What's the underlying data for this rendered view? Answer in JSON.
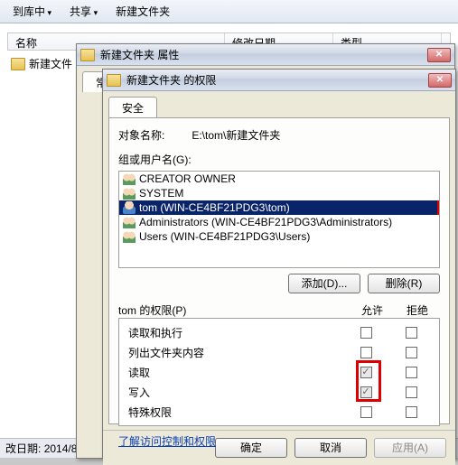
{
  "explorer": {
    "toolbar": {
      "include": "到库中",
      "share": "共享",
      "new_folder": "新建文件夹"
    },
    "columns": {
      "name": "名称",
      "modified": "修改日期",
      "type": "类型"
    },
    "file_row": "新建文件",
    "status_prefix": "改日期:",
    "status_date": "2014/8"
  },
  "props_window": {
    "title": "新建文件夹 属性",
    "tab_general": "常"
  },
  "perm_window": {
    "title": "新建文件夹 的权限",
    "tab_security": "安全",
    "object_label": "对象名称:",
    "object_value": "E:\\tom\\新建文件夹",
    "group_label": "组或用户名(G):",
    "users": [
      {
        "type": "group",
        "name": "CREATOR OWNER"
      },
      {
        "type": "group",
        "name": "SYSTEM"
      },
      {
        "type": "user",
        "name": "tom (WIN-CE4BF21PDG3\\tom)",
        "selected": true
      },
      {
        "type": "group",
        "name": "Administrators (WIN-CE4BF21PDG3\\Administrators)"
      },
      {
        "type": "group",
        "name": "Users (WIN-CE4BF21PDG3\\Users)"
      }
    ],
    "add_btn": "添加(D)...",
    "remove_btn": "删除(R)",
    "perm_for_label": "tom 的权限(P)",
    "allow": "允许",
    "deny": "拒绝",
    "perms": [
      {
        "label": "读取和执行",
        "allow": "unchecked",
        "deny": "unchecked"
      },
      {
        "label": "列出文件夹内容",
        "allow": "unchecked",
        "deny": "unchecked"
      },
      {
        "label": "读取",
        "allow": "checked-gray",
        "deny": "unchecked",
        "red": true
      },
      {
        "label": "写入",
        "allow": "checked-gray",
        "deny": "unchecked",
        "red": true
      },
      {
        "label": "特殊权限",
        "allow": "unchecked",
        "deny": "unchecked"
      }
    ],
    "learn_link": "了解访问控制和权限",
    "ok": "确定",
    "cancel": "取消",
    "apply": "应用(A)"
  }
}
